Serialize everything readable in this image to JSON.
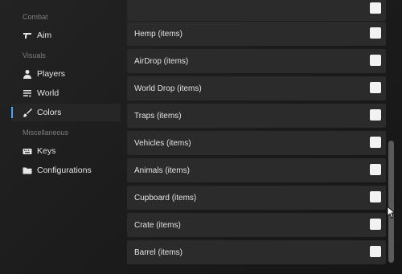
{
  "sidebar": {
    "sections": [
      {
        "title": "Combat"
      },
      {
        "title": "Visuals"
      },
      {
        "title": "Miscellaneous"
      }
    ],
    "items": [
      {
        "label": "Aim",
        "icon": "gun-icon"
      },
      {
        "label": "Players",
        "icon": "person-icon"
      },
      {
        "label": "World",
        "icon": "list-icon"
      },
      {
        "label": "Colors",
        "icon": "brush-icon",
        "active": true
      },
      {
        "label": "Keys",
        "icon": "keyboard-icon"
      },
      {
        "label": "Configurations",
        "icon": "folder-icon"
      }
    ]
  },
  "list": {
    "rows": [
      {
        "label": ""
      },
      {
        "label": "Hemp (items)"
      },
      {
        "label": "AirDrop (items)"
      },
      {
        "label": "World Drop (items)"
      },
      {
        "label": "Traps (items)"
      },
      {
        "label": "Vehicles (items)"
      },
      {
        "label": "Animals (items)"
      },
      {
        "label": "Cupboard (items)"
      },
      {
        "label": "Crate (items)"
      },
      {
        "label": "Barrel (items)"
      }
    ]
  },
  "colors": {
    "accent": "#4aa3ff",
    "row_bg": "#2b2b2b",
    "checkbox": "#f2f2f2"
  }
}
